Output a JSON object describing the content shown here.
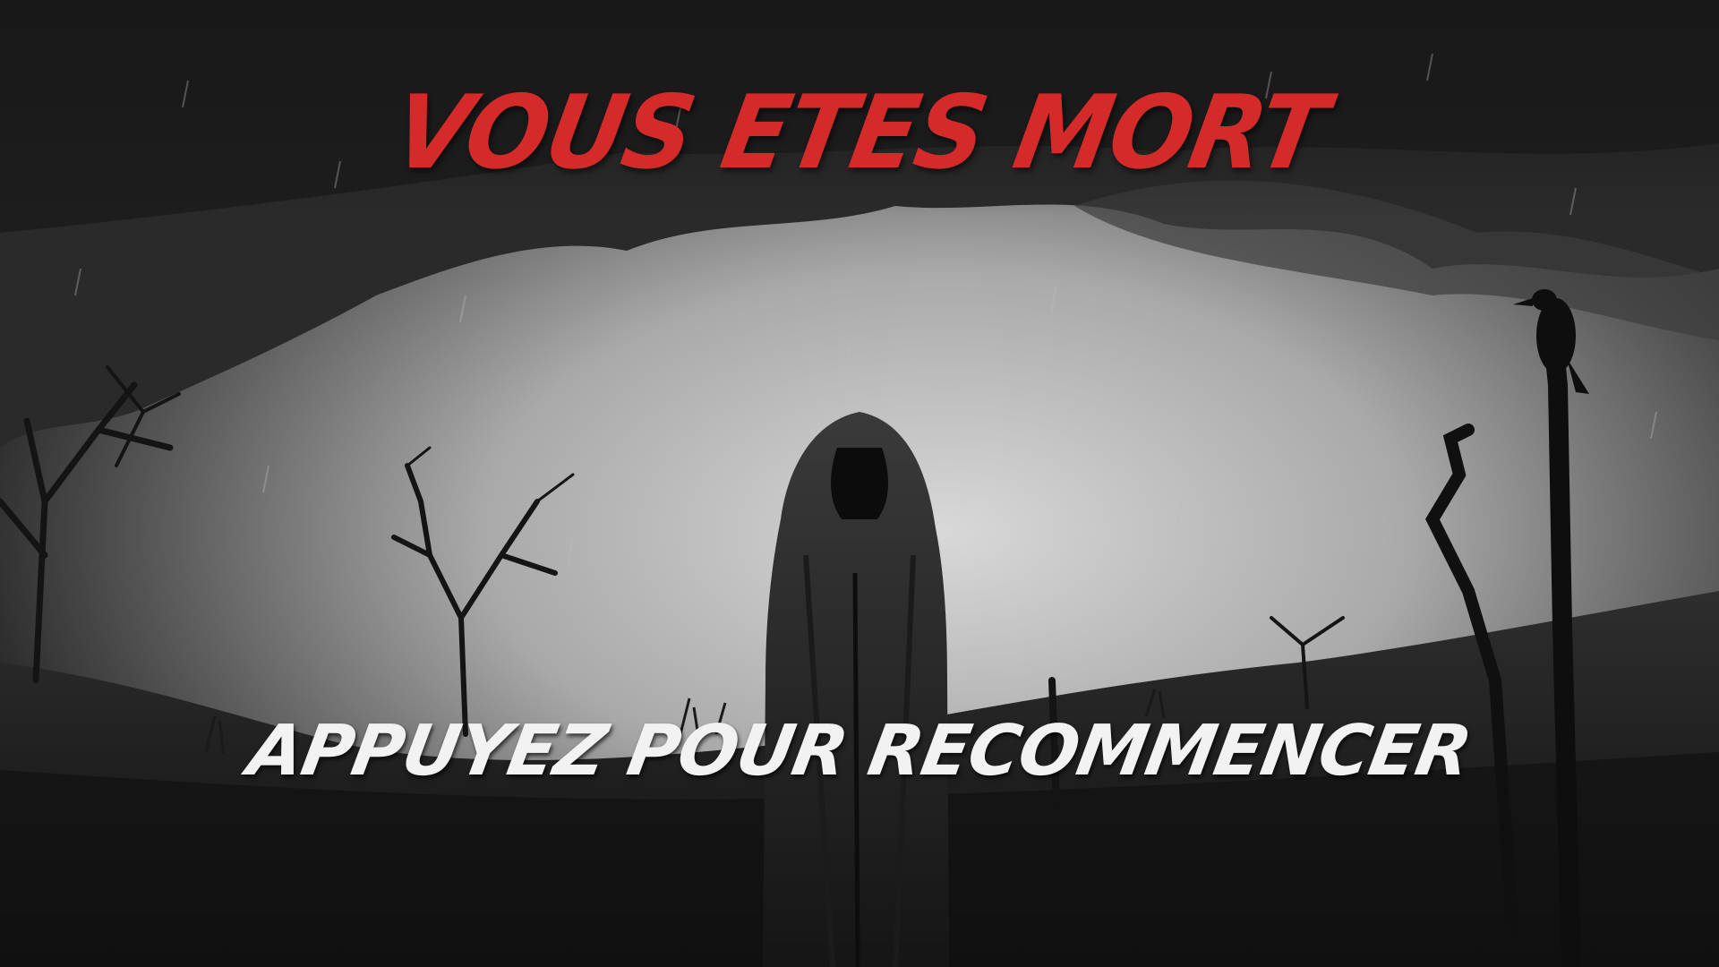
{
  "game": {
    "death_title": "VOUS ETES MORT",
    "restart_prompt": "APPUYEZ POUR RECOMMENCER"
  },
  "colors": {
    "title": "#d42a2a",
    "prompt": "#f2f2f2",
    "sky_light": "#c9c9c9",
    "sky_dark": "#2b2b2b",
    "ground": "#1c1c1c"
  },
  "scene": {
    "elements": [
      "storm-clouds",
      "rain",
      "hooded-reaper",
      "crow-on-staff",
      "dead-trees",
      "barren-hill"
    ]
  }
}
